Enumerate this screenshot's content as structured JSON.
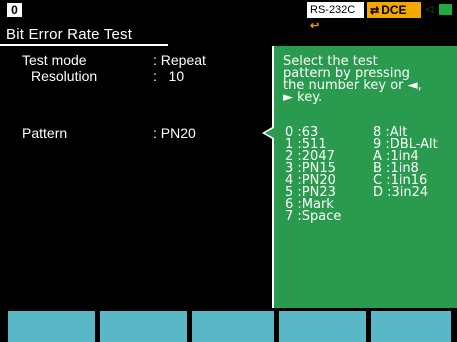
{
  "status_bar": {
    "tab_number": "0",
    "rs_label": "RS-232C",
    "rs_plug_icon": "plug-icon",
    "dce_label": "DCE",
    "dce_arrows_icon": "bidirectional-arrows-icon",
    "mini_icon": "small-status-icon",
    "battery_icon": "battery-icon"
  },
  "screen": {
    "title": "Bit Error Rate Test"
  },
  "settings": {
    "test_mode_label": "Test mode",
    "test_mode_value": ": Repeat",
    "resolution_label": "Resolution",
    "resolution_value": ":   10",
    "pattern_label": "Pattern",
    "pattern_value": ": PN20"
  },
  "help": {
    "lines": [
      "Select the test",
      "pattern by pressing",
      "the number key or ◄,",
      "► key."
    ],
    "patterns_left": [
      "0 :63",
      "1 :511",
      "2 :2047",
      "3 :PN15",
      "4 :PN20",
      "5 :PN23",
      "6 :Mark",
      "7 :Space"
    ],
    "patterns_right": [
      "8 :Alt",
      "9 :DBL-Alt",
      "A :1in4",
      "B :1in8",
      "C :1in16",
      "D :3in24"
    ]
  },
  "colors": {
    "help_bg": "#2a9a4e",
    "fkey_bg": "#5ab7c5",
    "dce_badge": "#f5a800",
    "battery": "#23a844"
  }
}
